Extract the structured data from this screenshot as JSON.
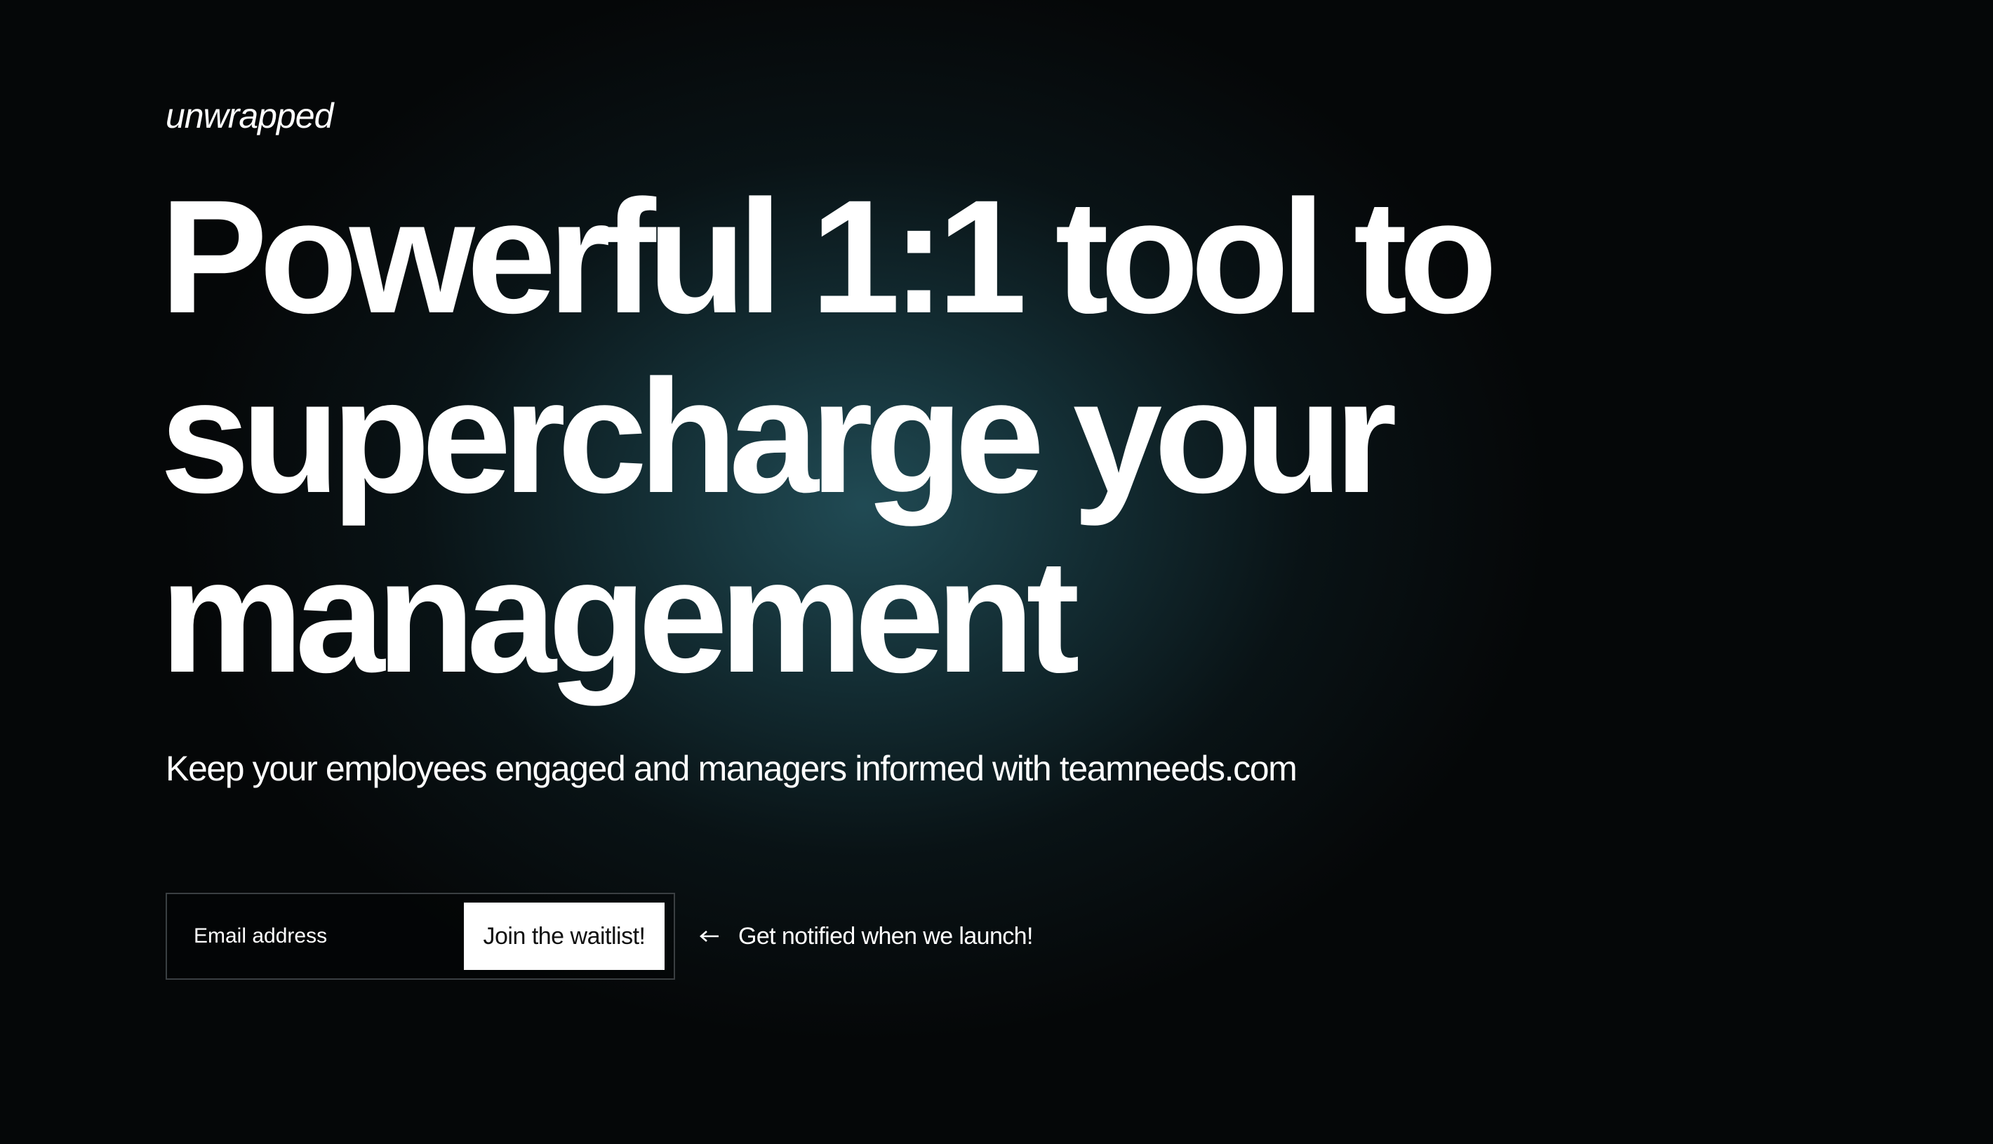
{
  "brand": {
    "name": "unwrapped"
  },
  "hero": {
    "headline_lines": [
      "Powerful 1:1 tool to",
      "supercharge your",
      "management"
    ],
    "subheadline": "Keep your employees engaged and managers informed with teamneeds.com"
  },
  "signup": {
    "email_placeholder": "Email address",
    "email_value": "",
    "submit_label": "Join the waitlist!",
    "hint_icon": "arrow-left-icon",
    "hint_text": "Get notified when we launch!"
  },
  "colors": {
    "background": "#050708",
    "glow": "#224e58",
    "text": "#ffffff",
    "button_bg": "#ffffff",
    "button_text": "#111111",
    "input_border": "#3a3f42"
  }
}
